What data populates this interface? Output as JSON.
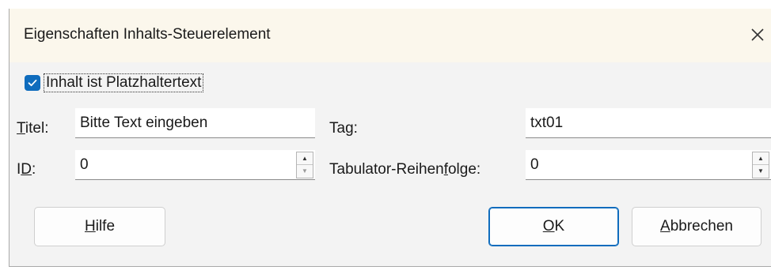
{
  "dialog": {
    "title": "Eigenschaften Inhalts-Steuerelement",
    "close_icon": "close-icon"
  },
  "placeholder_checkbox": {
    "checked": true,
    "label": "Inhalt ist Platzhaltertext"
  },
  "fields": {
    "title": {
      "label": "Titel:",
      "mnemonic": "T",
      "label_rest": "itel:",
      "value": "Bitte Text eingeben"
    },
    "tag": {
      "label": "Tag:",
      "label_pre": "Ta",
      "mnemonic": "g",
      "label_rest": ":",
      "value": "txt01"
    },
    "id": {
      "label": "ID:",
      "label_pre": "I",
      "mnemonic": "D",
      "label_rest": ":",
      "value": "0"
    },
    "tab_order": {
      "label": "Tabulator-Reihenfolge:",
      "label_pre": "Tabulator-Reihen",
      "mnemonic": "f",
      "label_rest": "olge:",
      "value": "0"
    }
  },
  "buttons": {
    "help": {
      "label": "Hilfe",
      "mnemonic": "H",
      "label_rest": "ilfe"
    },
    "ok": {
      "label": "OK",
      "mnemonic": "O",
      "label_rest": "K"
    },
    "cancel": {
      "label": "Abbrechen",
      "mnemonic": "A",
      "label_rest": "bbrechen"
    }
  },
  "colors": {
    "accent": "#0f6cbd",
    "titlebar_bg": "#fbf7ec",
    "dialog_bg": "#f3f3f3"
  }
}
